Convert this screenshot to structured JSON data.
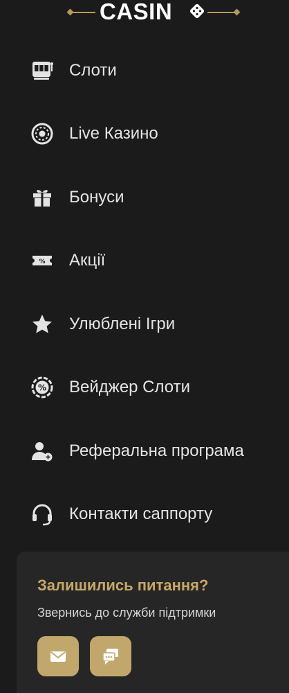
{
  "header": {
    "logo_text": "CASIN",
    "logo_die": "die-icon"
  },
  "nav": {
    "items": [
      {
        "label": "Слоти",
        "icon": "slot-machine-icon"
      },
      {
        "label": "Live Казино",
        "icon": "roulette-icon"
      },
      {
        "label": "Бонуси",
        "icon": "gift-icon"
      },
      {
        "label": "Акції",
        "icon": "percent-ticket-icon"
      },
      {
        "label": "Улюблені Ігри",
        "icon": "star-icon"
      },
      {
        "label": "Вейджер Слоти",
        "icon": "percent-chip-icon"
      },
      {
        "label": "Реферальна програма",
        "icon": "user-add-icon"
      },
      {
        "label": "Контакти саппорту",
        "icon": "headset-icon"
      }
    ]
  },
  "support": {
    "title": "Залишились питання?",
    "subtitle": "Звернись до служби підтримки",
    "mail_icon": "mail-icon",
    "chat_icon": "chat-icon"
  },
  "colors": {
    "background": "#1b1b1c",
    "card": "#262627",
    "accent": "#c2a76c",
    "accent_text": "#c7a865",
    "text": "#e4e4e4"
  }
}
